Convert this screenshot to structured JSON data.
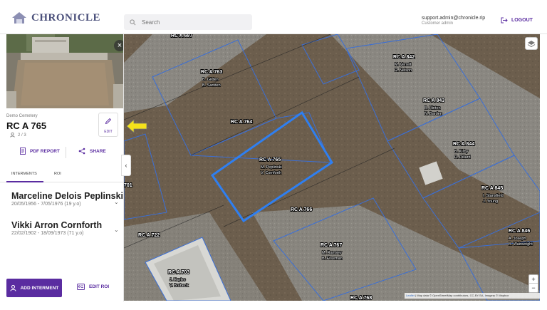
{
  "header": {
    "logo_text": "CHRONICLE",
    "search_placeholder": "Search",
    "user_email": "support.admin@chronicle.rip",
    "user_role": "Customer admin",
    "logout_label": "LOGOUT"
  },
  "sidebar": {
    "cemetery": "Demo Cemetery",
    "plot_title": "RC A 765",
    "plot_count": "2 / 3",
    "edit_label": "EDIT",
    "pdf_label": "PDF REPORT",
    "share_label": "SHARE",
    "tabs": [
      {
        "label": "INTERMENTS",
        "active": true
      },
      {
        "label": "ROI",
        "active": false
      }
    ],
    "interments": [
      {
        "name": "Marceline Delois Peplinski",
        "dates": "20/05/1956 - 7/05/1976 (19 y.o)"
      },
      {
        "name": "Vikki Arron Cornforth",
        "dates": "22/02/1902 - 18/09/1973 (71 y.o)"
      }
    ],
    "add_interment_label": "ADD INTERMENT",
    "edit_roi_label": "EDIT ROI"
  },
  "map": {
    "attribution_prefix": "Leaflet",
    "attribution_text": "| Map data © OpenStreetMap contributors, CC-BY-SA, Imagery © Mapbox",
    "zoom_in": "+",
    "zoom_out": "−",
    "plots": [
      {
        "id": "RC A 763",
        "names": [
          "B. Gilden",
          "B. Sanden"
        ]
      },
      {
        "id": "RC A 764",
        "names": []
      },
      {
        "id": "RC A 765",
        "names": [
          "M. Peplinski",
          "V. Cornforth"
        ],
        "selected": true
      },
      {
        "id": "RC A 766",
        "names": []
      },
      {
        "id": "RC A 767",
        "names": [
          "M. Ramsey",
          "B. Freeman"
        ]
      },
      {
        "id": "RC A 768",
        "names": []
      },
      {
        "id": "RC A 842",
        "names": [
          "M. Verrell",
          "R. Nelson"
        ]
      },
      {
        "id": "RC A 843",
        "names": [
          "B. Hinton",
          "N. Barden"
        ]
      },
      {
        "id": "RC A 844",
        "names": [
          "B. Kirby",
          "R. Dillard"
        ]
      },
      {
        "id": "RC A 845",
        "names": [
          "I. Stansfield",
          "J. Young"
        ]
      },
      {
        "id": "RC A 846",
        "names": [
          "A. Joseph",
          "B. Wainwright"
        ]
      },
      {
        "id": "RC A 703",
        "names": [
          "J. Hayles",
          "V. Brubeck"
        ]
      },
      {
        "id": "RC A 722",
        "names": []
      },
      {
        "id": "RC A 697",
        "names": []
      },
      {
        "id": "701",
        "names": []
      }
    ]
  },
  "colors": {
    "accent": "#5a2ca0",
    "selected_plot": "#2f7ff0",
    "plot_outline": "#3b6fd6",
    "arrow": "#f5e21a"
  }
}
